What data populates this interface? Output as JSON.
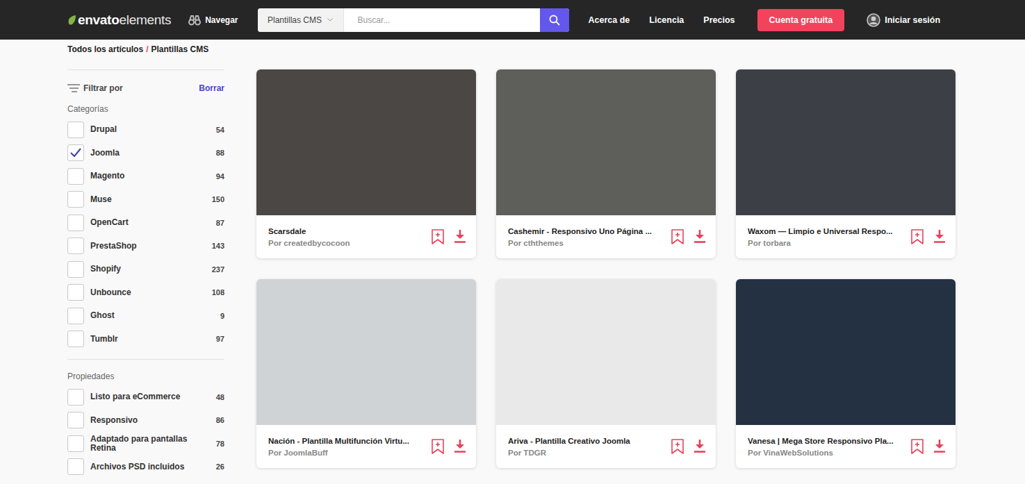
{
  "nav": {
    "logo": {
      "brand": "envato",
      "product": "elements"
    },
    "browse": "Navegar",
    "search": {
      "category": "Plantillas CMS",
      "placeholder": "Buscar..."
    },
    "links": [
      "Acerca de",
      "Licencia",
      "Precios"
    ],
    "cta": "Cuenta gratuita",
    "signin": "Iniciar sesión"
  },
  "breadcrumb": {
    "items": [
      "Todos los artículos",
      "Plantillas CMS"
    ],
    "separator": "/"
  },
  "filters": {
    "title": "Filtrar por",
    "clear": "Borrar",
    "groups": [
      {
        "title": "Categorías",
        "items": [
          {
            "label": "Drupal",
            "count": "54",
            "checked": false
          },
          {
            "label": "Joomla",
            "count": "88",
            "checked": true
          },
          {
            "label": "Magento",
            "count": "94",
            "checked": false
          },
          {
            "label": "Muse",
            "count": "150",
            "checked": false
          },
          {
            "label": "OpenCart",
            "count": "87",
            "checked": false
          },
          {
            "label": "PrestaShop",
            "count": "143",
            "checked": false
          },
          {
            "label": "Shopify",
            "count": "237",
            "checked": false
          },
          {
            "label": "Unbounce",
            "count": "108",
            "checked": false
          },
          {
            "label": "Ghost",
            "count": "9",
            "checked": false
          },
          {
            "label": "Tumblr",
            "count": "97",
            "checked": false
          }
        ]
      },
      {
        "title": "Propiedades",
        "items": [
          {
            "label": "Listo para eCommerce",
            "count": "48",
            "checked": false
          },
          {
            "label": "Responsivo",
            "count": "86",
            "checked": false
          },
          {
            "label": "Adaptado para pantallas Retina",
            "count": "78",
            "checked": false
          },
          {
            "label": "Archivos PSD incluidos",
            "count": "26",
            "checked": false
          }
        ]
      }
    ]
  },
  "cards": [
    {
      "title": "Scarsdale",
      "author": "Por createdbycocoon",
      "color": "#4a4744"
    },
    {
      "title": "Cashemir - Responsivo Uno Página ...",
      "author": "Por cththemes",
      "color": "#5e5e5a"
    },
    {
      "title": "Waxom — Limpio e Universal Respo...",
      "author": "Por torbara",
      "color": "#3c4046"
    },
    {
      "title": "Nación - Plantilla Multifunción Virtu...",
      "author": "Por JoomlaBuff",
      "color": "#cfd3d6"
    },
    {
      "title": "Ariva - Plantilla Creativo Joomla",
      "author": "Por TDGR",
      "color": "#e9e9e9"
    },
    {
      "title": "Vanesa | Mega Store Responsivo Pla...",
      "author": "Por VinaWebSolutions",
      "color": "#243142"
    }
  ]
}
